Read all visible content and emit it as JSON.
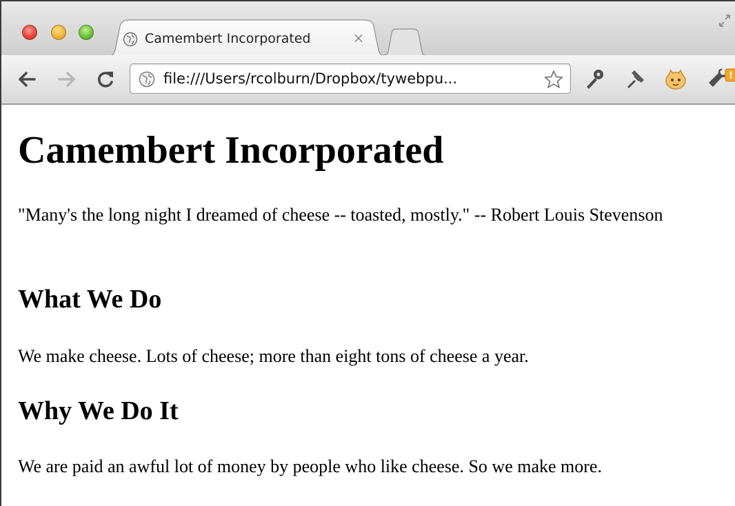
{
  "browser": {
    "tab": {
      "title": "Camembert Incorporated",
      "close_glyph": "×",
      "icon": "globe-icon"
    },
    "new_tab_icon": "new-tab-icon",
    "fullscreen_icon": "fullscreen-icon",
    "toolbar": {
      "back_icon": "back-arrow-icon",
      "forward_icon": "forward-arrow-icon",
      "reload_icon": "reload-icon",
      "url": "file:///Users/rcolburn/Dropbox/tywebpu...",
      "address_icon": "globe-icon",
      "bookmark_icon": "star-icon",
      "extensions": [
        "wrench-key-icon",
        "pin-icon",
        "extension-icon",
        "settings-wrench-icon"
      ],
      "badge_text": "!"
    },
    "colors": {
      "close": "#e4463a",
      "minimize": "#f2b33a",
      "zoom": "#6cc13c",
      "badge": "#f5a623"
    }
  },
  "page": {
    "heading": "Camembert Incorporated",
    "quote": "\"Many's the long night I dreamed of cheese -- toasted, mostly.\" -- Robert Louis Stevenson",
    "sections": [
      {
        "heading": "What We Do",
        "text": "We make cheese. Lots of cheese; more than eight tons of cheese a year."
      },
      {
        "heading": "Why We Do It",
        "text": "We are paid an awful lot of money by people who like cheese. So we make more."
      }
    ]
  }
}
